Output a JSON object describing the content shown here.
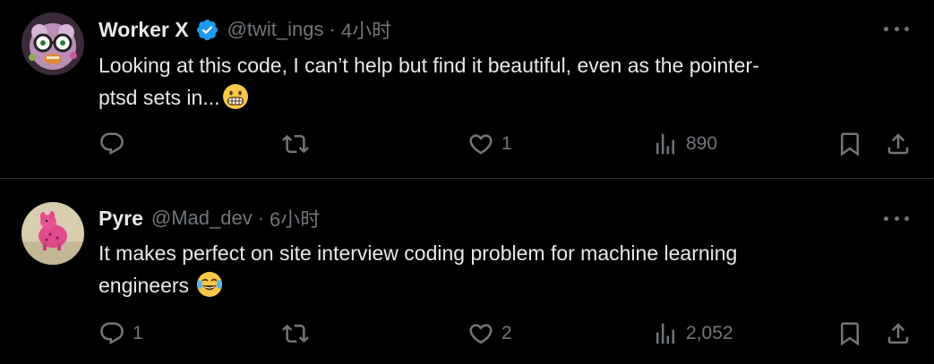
{
  "colors": {
    "background": "#000000",
    "text_primary": "#e7e9ea",
    "text_secondary": "#71767b",
    "divider": "#2f3336",
    "verified_blue": "#1d9bf0"
  },
  "tweets": [
    {
      "display_name": "Worker X",
      "verified": true,
      "handle": "@twit_ings",
      "separator": "·",
      "time": "4小时",
      "text": "Looking at this code, I can’t help but find it beautiful, even as the pointer-ptsd sets in...",
      "text_line1": "Looking at this code, I can’t help but find it beautiful, even as the pointer-",
      "text_line2": "ptsd sets in...",
      "emoji": "grimacing-face",
      "avatar": "skull-glasses-avatar",
      "actions": {
        "reply_count": "",
        "retweet_count": "",
        "like_count": "1",
        "views_count": "890"
      }
    },
    {
      "display_name": "Pyre",
      "verified": false,
      "handle": "@Mad_dev",
      "separator": "·",
      "time": "6小时",
      "text_line1": "It makes perfect on site interview coding problem for machine learning",
      "text_line2": "engineers",
      "emoji": "face-with-tears-of-joy",
      "avatar": "pink-toy-avatar",
      "actions": {
        "reply_count": "1",
        "retweet_count": "",
        "like_count": "2",
        "views_count": "2,052"
      }
    }
  ]
}
